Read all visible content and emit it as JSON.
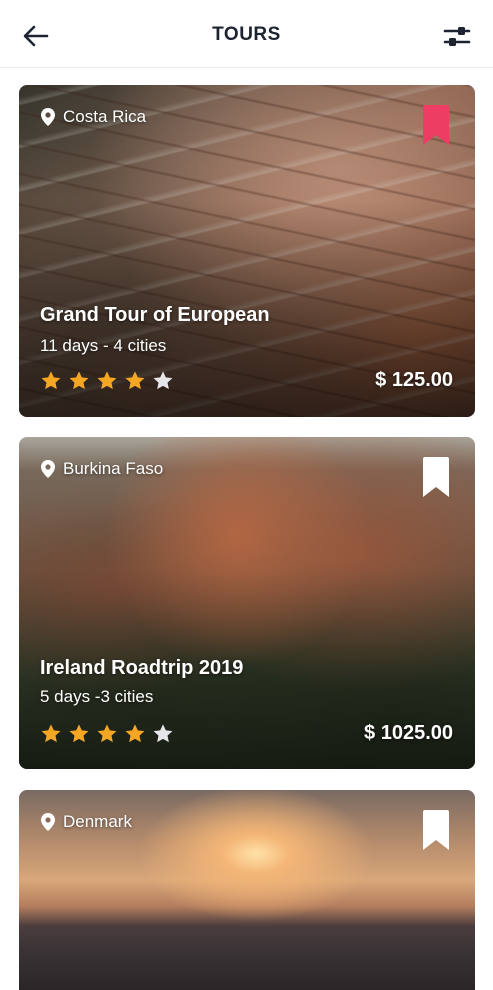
{
  "header": {
    "title": "TOURS",
    "back_icon": "arrow-left-icon",
    "filter_icon": "sliders-icon"
  },
  "colors": {
    "star_filled": "#f5a623",
    "star_empty": "#e6e6ea",
    "bookmark_active": "#ee3d63",
    "bookmark_inactive": "#ffffff"
  },
  "tours": [
    {
      "location": "Costa Rica",
      "title": "Grand Tour of European",
      "meta": "11 days - 4 cities",
      "price": "$ 125.00",
      "rating": 4,
      "max_rating": 5,
      "bookmarked": true
    },
    {
      "location": "Burkina Faso",
      "title": "Ireland Roadtrip 2019",
      "meta": "5 days -3 cities",
      "price": "$ 1025.00",
      "rating": 4,
      "max_rating": 5,
      "bookmarked": false
    },
    {
      "location": "Denmark",
      "bookmarked": false
    }
  ]
}
